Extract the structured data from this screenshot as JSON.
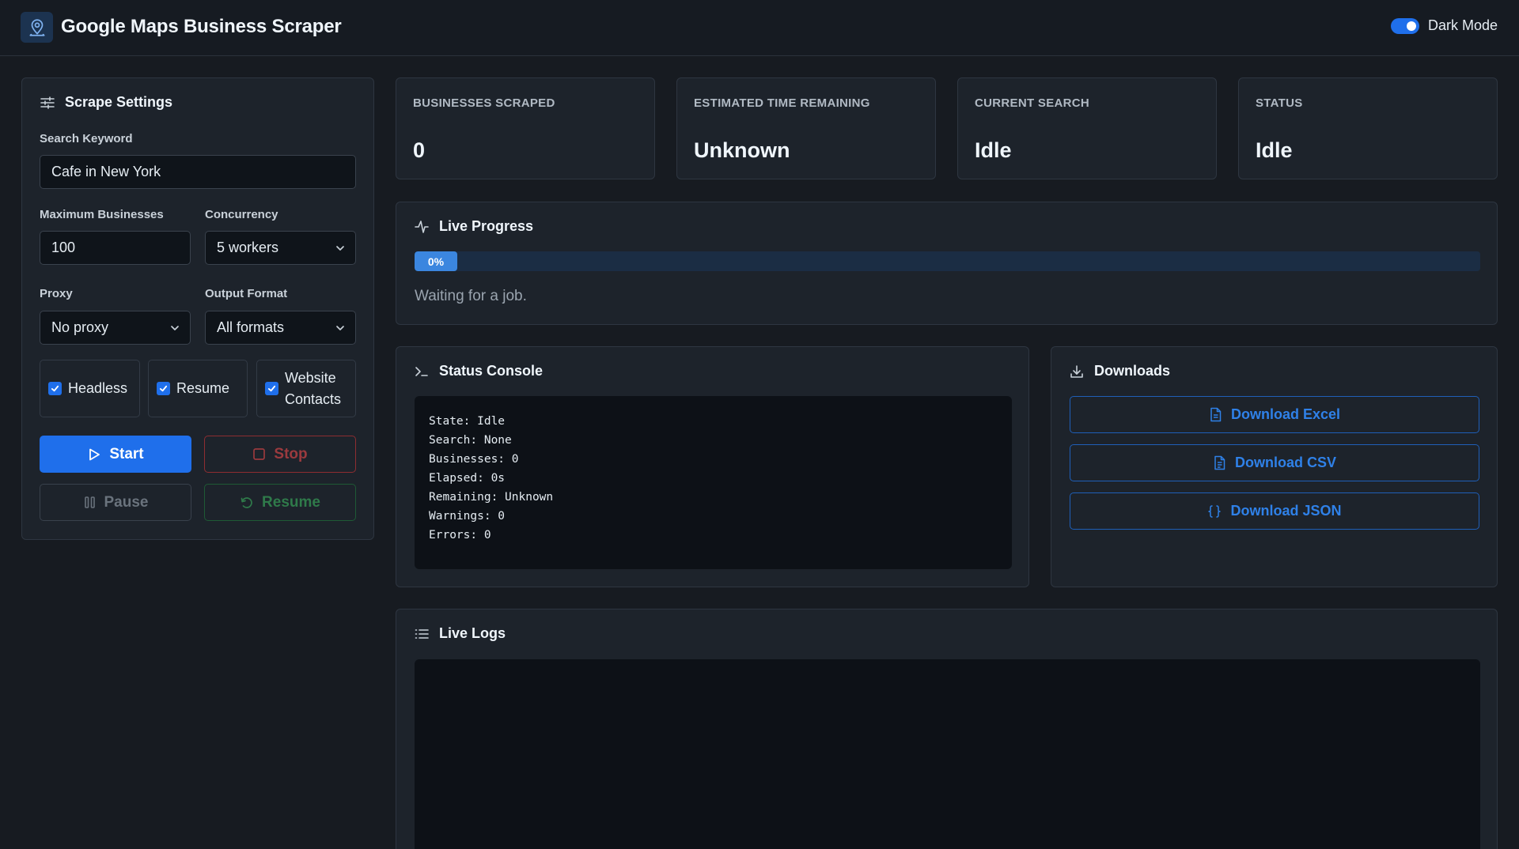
{
  "header": {
    "title": "Google Maps Business Scraper",
    "dark_mode_label": "Dark Mode",
    "dark_mode_on": true,
    "logo_icon": "user-pin-icon"
  },
  "settings": {
    "title": "Scrape Settings",
    "keyword_label": "Search Keyword",
    "keyword_value": "Cafe in New York",
    "max_label": "Maximum Businesses",
    "max_value": "100",
    "concurrency_label": "Concurrency",
    "concurrency_value": "5 workers",
    "proxy_label": "Proxy",
    "proxy_value": "No proxy",
    "format_label": "Output Format",
    "format_value": "All formats",
    "checkboxes": [
      {
        "label": "Headless",
        "checked": true
      },
      {
        "label": "Resume",
        "checked": true
      },
      {
        "label_line1": "Website",
        "label_line2": "Contacts",
        "checked": true
      }
    ],
    "buttons": {
      "start": "Start",
      "stop": "Stop",
      "pause": "Pause",
      "resume": "Resume"
    }
  },
  "stats": [
    {
      "label": "BUSINESSES SCRAPED",
      "value": "0"
    },
    {
      "label": "ESTIMATED TIME REMAINING",
      "value": "Unknown"
    },
    {
      "label": "CURRENT SEARCH",
      "value": "Idle"
    },
    {
      "label": "STATUS",
      "value": "Idle"
    }
  ],
  "progress": {
    "title": "Live Progress",
    "percent_label": "0%",
    "percent": 0,
    "message": "Waiting for a job."
  },
  "console": {
    "title": "Status Console",
    "lines": [
      "State: Idle",
      "Search: None",
      "Businesses: 0",
      "Elapsed: 0s",
      "Remaining: Unknown",
      "Warnings: 0",
      "Errors: 0"
    ]
  },
  "downloads": {
    "title": "Downloads",
    "excel": "Download Excel",
    "csv": "Download CSV",
    "json": "Download JSON"
  },
  "logs": {
    "title": "Live Logs"
  },
  "colors": {
    "accent": "#1f6feb",
    "background": "#171b21",
    "panel": "#1d232b",
    "danger": "#8e2d31",
    "success": "#1e5a35"
  }
}
